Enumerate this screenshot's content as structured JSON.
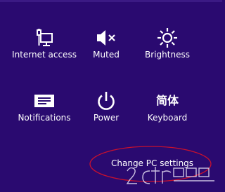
{
  "settings_panel": {
    "accent_color": "#2a0a70",
    "tiles": [
      {
        "id": "internet",
        "label": "Internet access",
        "icon": "network-icon"
      },
      {
        "id": "muted",
        "label": "Muted",
        "icon": "speaker-muted-icon"
      },
      {
        "id": "brightness",
        "label": "Brightness",
        "icon": "brightness-icon"
      },
      {
        "id": "notifications",
        "label": "Notifications",
        "icon": "notifications-icon"
      },
      {
        "id": "power",
        "label": "Power",
        "icon": "power-icon"
      },
      {
        "id": "keyboard",
        "label": "Keyboard",
        "icon": "keyboard-icon",
        "glyph": "简体"
      }
    ],
    "change_pc_settings": "Change PC settings",
    "annotation_color": "#c8102e"
  }
}
